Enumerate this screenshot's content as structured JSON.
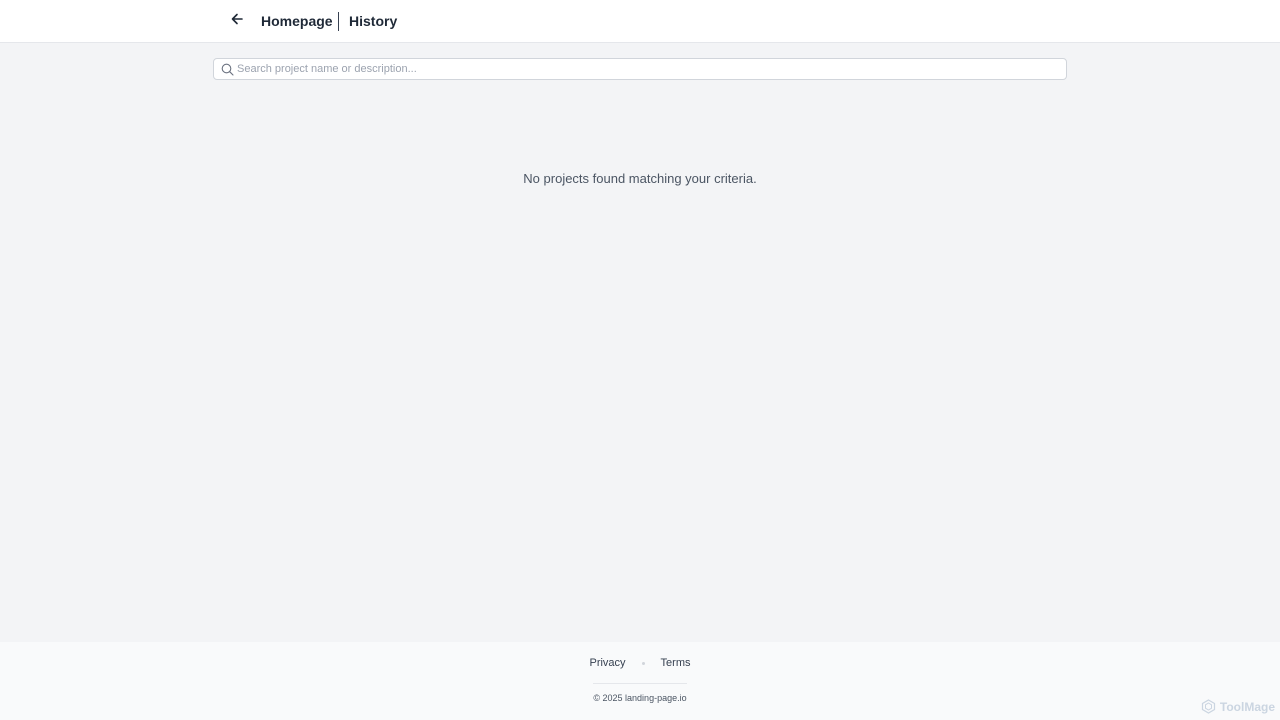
{
  "header": {
    "back_icon": "arrow-left-icon",
    "breadcrumb_home": "Homepage",
    "breadcrumb_current": "History"
  },
  "search": {
    "icon": "search-icon",
    "value": "",
    "placeholder": "Search project name or description..."
  },
  "main": {
    "empty_message": "No projects found matching your criteria."
  },
  "footer": {
    "privacy_label": "Privacy",
    "terms_label": "Terms",
    "copyright": "© 2025 landing-page.io"
  },
  "watermark": {
    "logo_icon": "toolmage-logo-icon",
    "text": "ToolMage"
  },
  "colors": {
    "page_background": "#f3f4f6",
    "header_background": "#ffffff",
    "text_primary": "#1f2937",
    "text_muted": "#9ca3af"
  }
}
